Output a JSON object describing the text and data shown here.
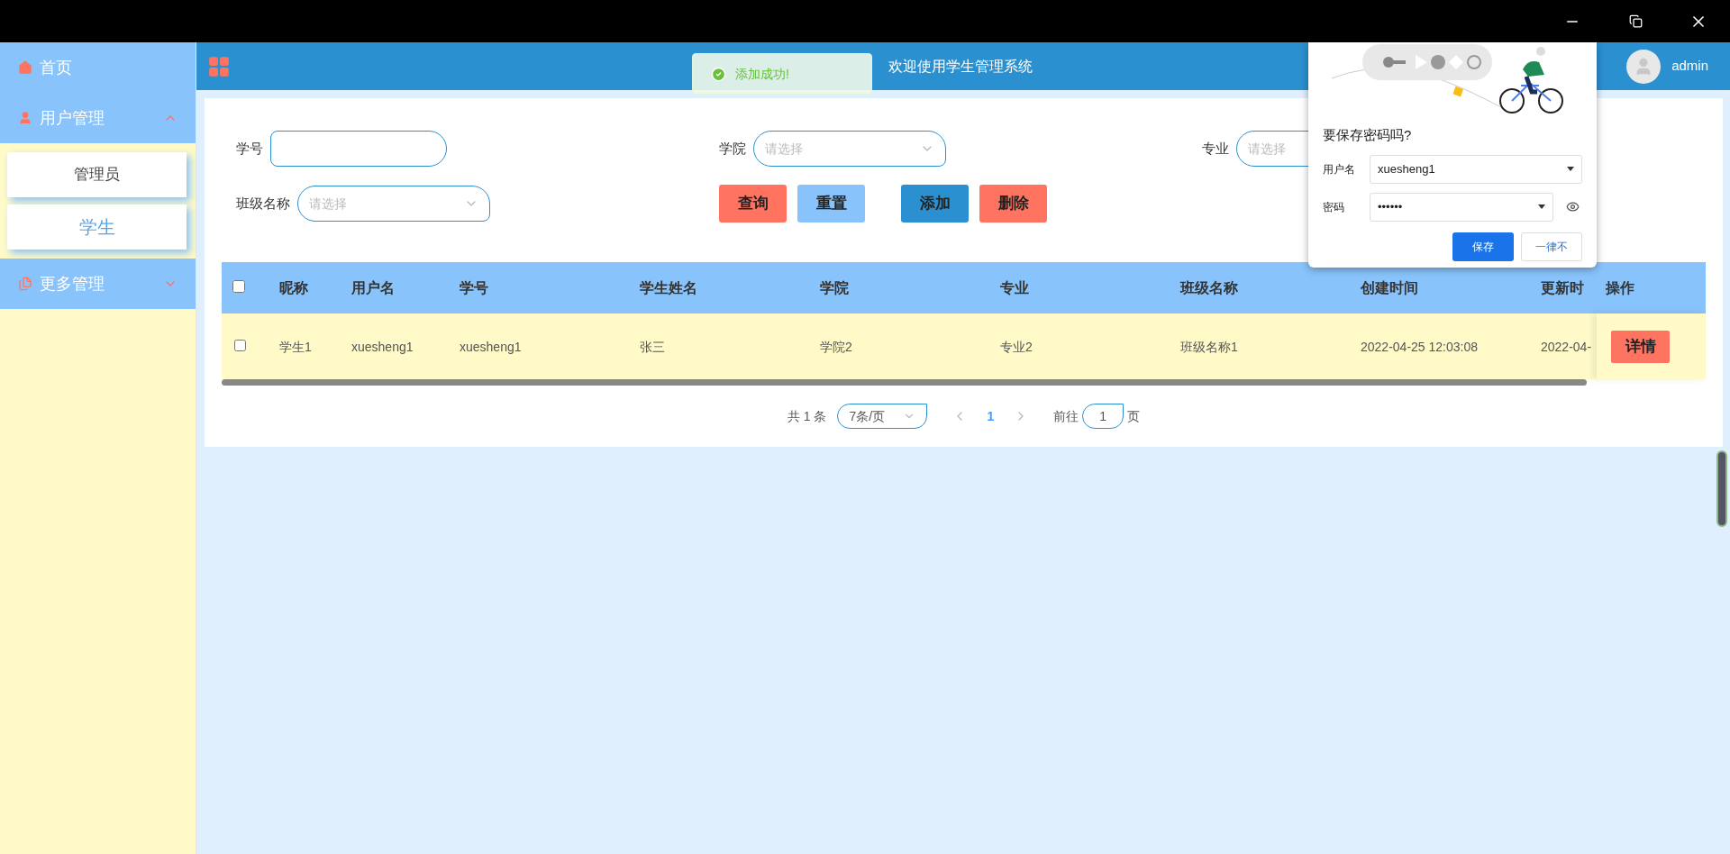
{
  "header": {
    "title": "欢迎使用学生管理系统",
    "user": "admin"
  },
  "toast": {
    "message": "添加成功!"
  },
  "sidebar": {
    "items": [
      {
        "label": "首页",
        "kind": "home"
      },
      {
        "label": "用户管理",
        "kind": "user",
        "expanded": true,
        "children": [
          {
            "label": "管理员",
            "selected": false
          },
          {
            "label": "学生",
            "selected": true
          }
        ]
      },
      {
        "label": "更多管理",
        "kind": "more",
        "expanded": false
      }
    ]
  },
  "filters": [
    {
      "label": "学号",
      "kind": "text"
    },
    {
      "label": "学院",
      "kind": "select",
      "placeholder": "请选择"
    },
    {
      "label": "专业",
      "kind": "select",
      "placeholder": "请选择"
    },
    {
      "label": "班级名称",
      "kind": "select",
      "placeholder": "请选择"
    }
  ],
  "buttons": [
    {
      "label": "查询",
      "color": "#ff7461"
    },
    {
      "label": "重置",
      "color": "#88c3fb"
    },
    {
      "label": "添加",
      "color": "#2b90d0"
    },
    {
      "label": "删除",
      "color": "#ff7461"
    }
  ],
  "table": {
    "all_checked": false,
    "columns": [
      "昵称",
      "用户名",
      "学号",
      "学生姓名",
      "学院",
      "专业",
      "班级名称",
      "创建时间",
      "更新时",
      "操作"
    ],
    "rows": [
      {
        "checked": false,
        "cells": [
          "学生1",
          "xuesheng1",
          "xuesheng1",
          "张三",
          "学院2",
          "专业2",
          "班级名称1",
          "2022-04-25 12:03:08",
          "2022-04-"
        ],
        "action": "详情"
      }
    ]
  },
  "pagination": {
    "total": "共 1 条",
    "page_size": "7条/页",
    "pages": [
      {
        "label": "1",
        "selected": true
      }
    ],
    "goto_label": "前往",
    "goto_value": "1",
    "goto_suffix": "页"
  },
  "save_password_dialog": {
    "title": "要保存密码吗?",
    "fields": [
      {
        "label": "用户名",
        "value": "xuesheng1"
      },
      {
        "label": "密码",
        "value": "••••••"
      }
    ],
    "buttons": [
      {
        "label": "保存",
        "kind": "primary"
      },
      {
        "label": "一律不",
        "kind": "secondary"
      }
    ]
  }
}
